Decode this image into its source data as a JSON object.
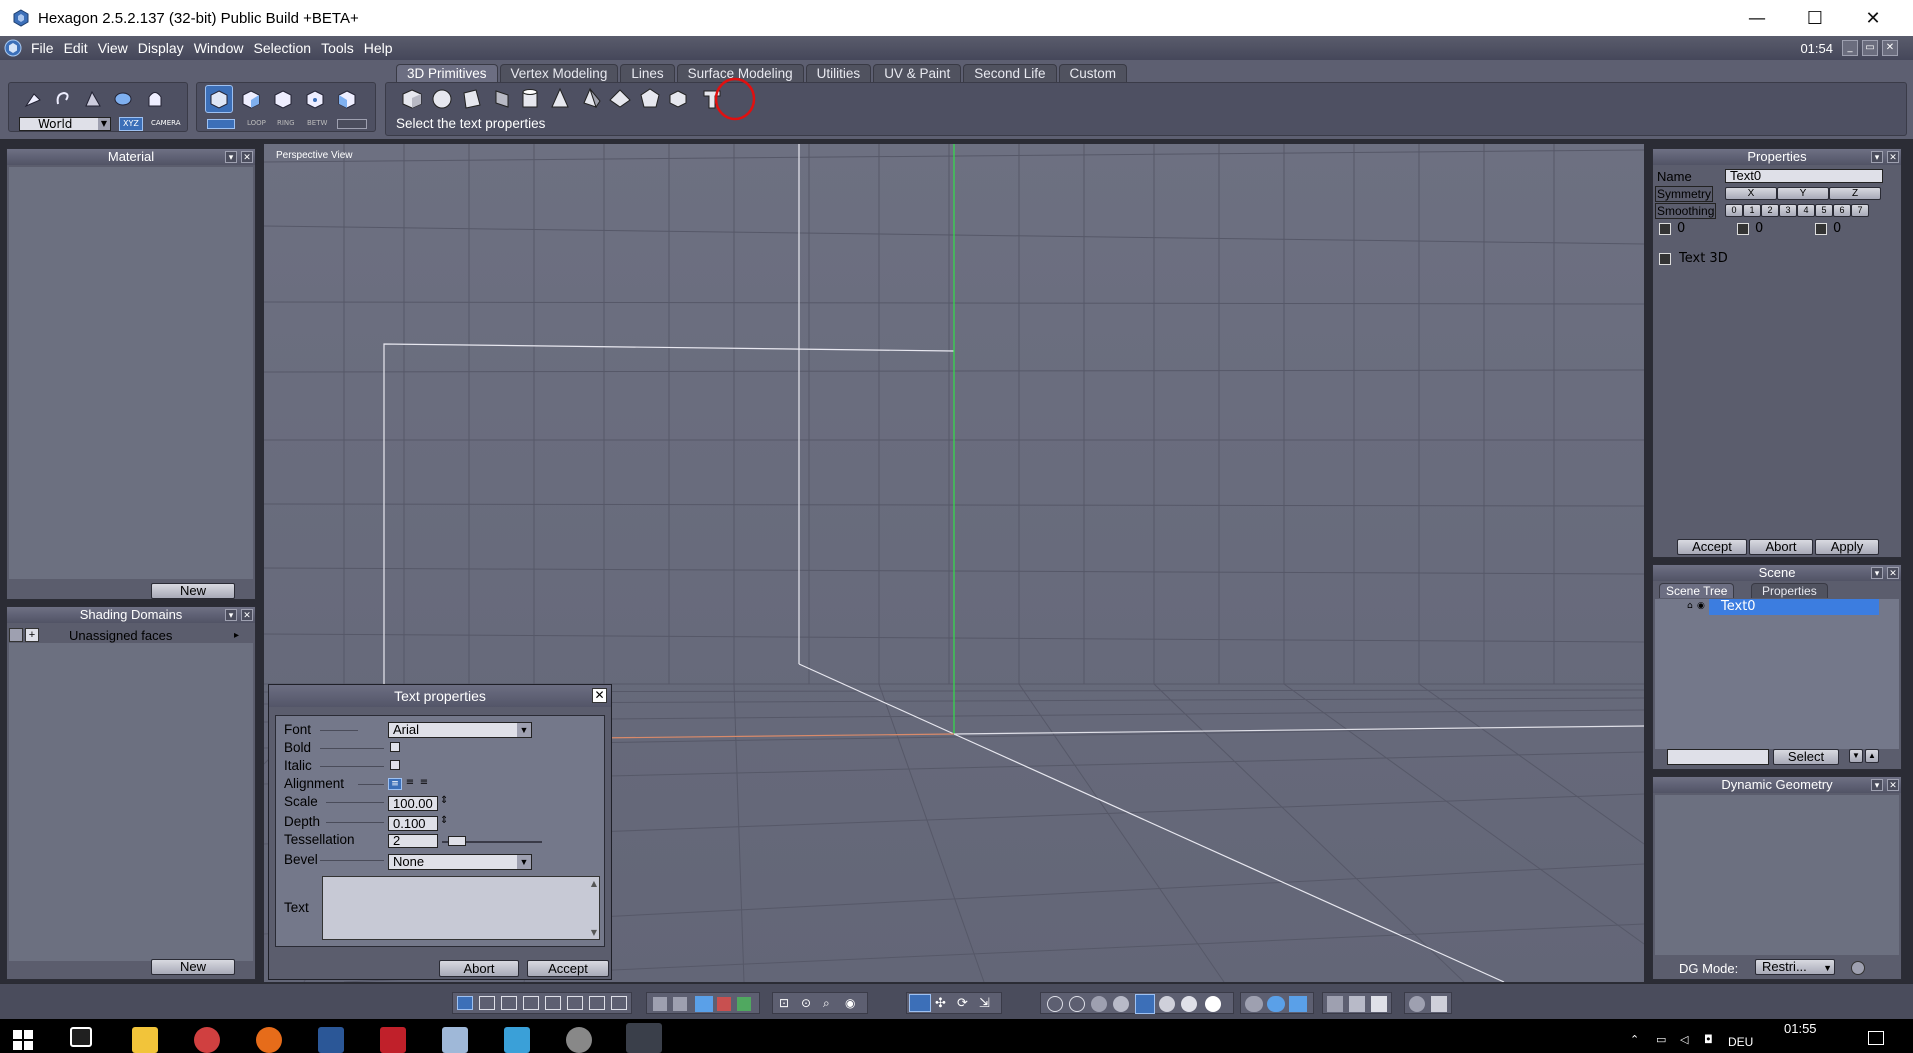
{
  "window": {
    "title": "Hexagon 2.5.2.137 (32-bit)  Public Build +BETA+",
    "minimize": "—",
    "maximize": "☐",
    "close": "✕"
  },
  "menu": {
    "items": [
      "File",
      "Edit",
      "View",
      "Display",
      "Window",
      "Selection",
      "Tools",
      "Help"
    ],
    "clock": "01:54"
  },
  "toolbar": {
    "coord_mode": "World",
    "xyz_label": "XYZ",
    "camera_label": "CAMERA",
    "loop_label": "LOOP",
    "ring_label": "RING",
    "betw_label": "BETW",
    "tabs": [
      "3D Primitives",
      "Vertex Modeling",
      "Lines",
      "Surface Modeling",
      "Utilities",
      "UV & Paint",
      "Second Life",
      "Custom"
    ],
    "active_tab": "3D Primitives",
    "hint": "Select the text properties"
  },
  "material_panel": {
    "title": "Material",
    "new_button": "New"
  },
  "shading_panel": {
    "title": "Shading Domains",
    "item": "Unassigned faces",
    "new_button": "New"
  },
  "viewport": {
    "label": "Perspective View"
  },
  "text_dialog": {
    "title": "Text properties",
    "font_label": "Font",
    "font_value": "Arial",
    "bold_label": "Bold",
    "italic_label": "Italic",
    "alignment_label": "Alignment",
    "scale_label": "Scale",
    "scale_value": "100.00",
    "depth_label": "Depth",
    "depth_value": "0.100",
    "tessellation_label": "Tessellation",
    "tessellation_value": "2",
    "bevel_label": "Bevel",
    "bevel_value": "None",
    "text_label": "Text",
    "abort_button": "Abort",
    "accept_button": "Accept"
  },
  "properties_panel": {
    "title": "Properties",
    "name_label": "Name",
    "name_value": "Text0",
    "symmetry_label": "Symmetry",
    "symmetry_axes": [
      "X",
      "Y",
      "Z"
    ],
    "smoothing_label": "Smoothing",
    "smoothing_levels": [
      "0",
      "1",
      "2",
      "3",
      "4",
      "5",
      "6",
      "7"
    ],
    "counts": [
      "0",
      "0",
      "0"
    ],
    "object_type": "Text 3D",
    "accept_button": "Accept",
    "abort_button": "Abort",
    "apply_button": "Apply"
  },
  "scene_panel": {
    "title": "Scene",
    "tab_tree": "Scene Tree",
    "tab_props": "Properties",
    "item": "Text0",
    "select_button": "Select"
  },
  "dynamic_panel": {
    "title": "Dynamic Geometry",
    "mode_label": "DG Mode:",
    "mode_value": "Restri..."
  },
  "taskbar": {
    "time": "01:55",
    "lang": "DEU"
  }
}
